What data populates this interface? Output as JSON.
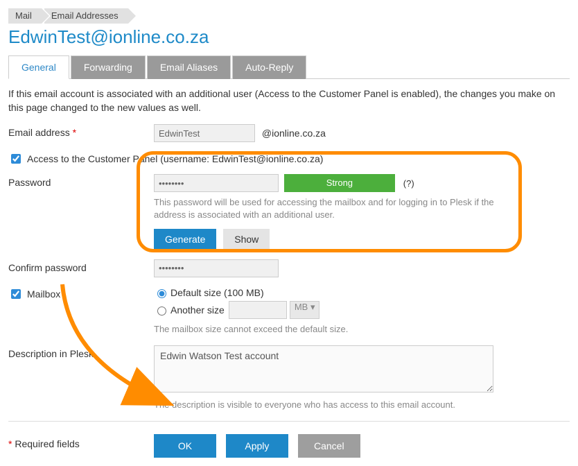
{
  "breadcrumb": {
    "items": [
      "Mail",
      "Email Addresses"
    ]
  },
  "page_title": "EdwinTest@ionline.co.za",
  "tabs": [
    {
      "label": "General",
      "active": true
    },
    {
      "label": "Forwarding",
      "active": false
    },
    {
      "label": "Email Aliases",
      "active": false
    },
    {
      "label": "Auto-Reply",
      "active": false
    }
  ],
  "intro_text": "If this email account is associated with an additional user (Access to the Customer Panel is enabled), the changes you make on this page changed to the new values as well.",
  "email_address": {
    "label": "Email address",
    "value": "EdwinTest",
    "domain": "@ionline.co.za"
  },
  "access_checkbox": {
    "checked": true,
    "label": "Access to the Customer Panel  (username: EdwinTest@ionline.co.za)"
  },
  "password": {
    "label": "Password",
    "value": "••••••••",
    "strength_label": "Strong",
    "help": "(?)",
    "hint": "This password will be used for accessing the mailbox and for logging in to Plesk if the address is associated with an additional user.",
    "generate_label": "Generate",
    "show_label": "Show"
  },
  "confirm_password": {
    "label": "Confirm password",
    "value": "••••••••"
  },
  "mailbox": {
    "checked": true,
    "label": "Mailbox",
    "default_size_label": "Default size (100 MB)",
    "another_size_label": "Another size",
    "another_size_value": "",
    "unit": "MB",
    "hint": "The mailbox size cannot exceed the default size."
  },
  "description": {
    "label": "Description in Plesk",
    "value": "Edwin Watson Test account",
    "hint": "The description is visible to everyone who has access to this email account."
  },
  "footer": {
    "required_text": "Required fields",
    "required_star": "*",
    "ok_label": "OK",
    "apply_label": "Apply",
    "cancel_label": "Cancel"
  }
}
